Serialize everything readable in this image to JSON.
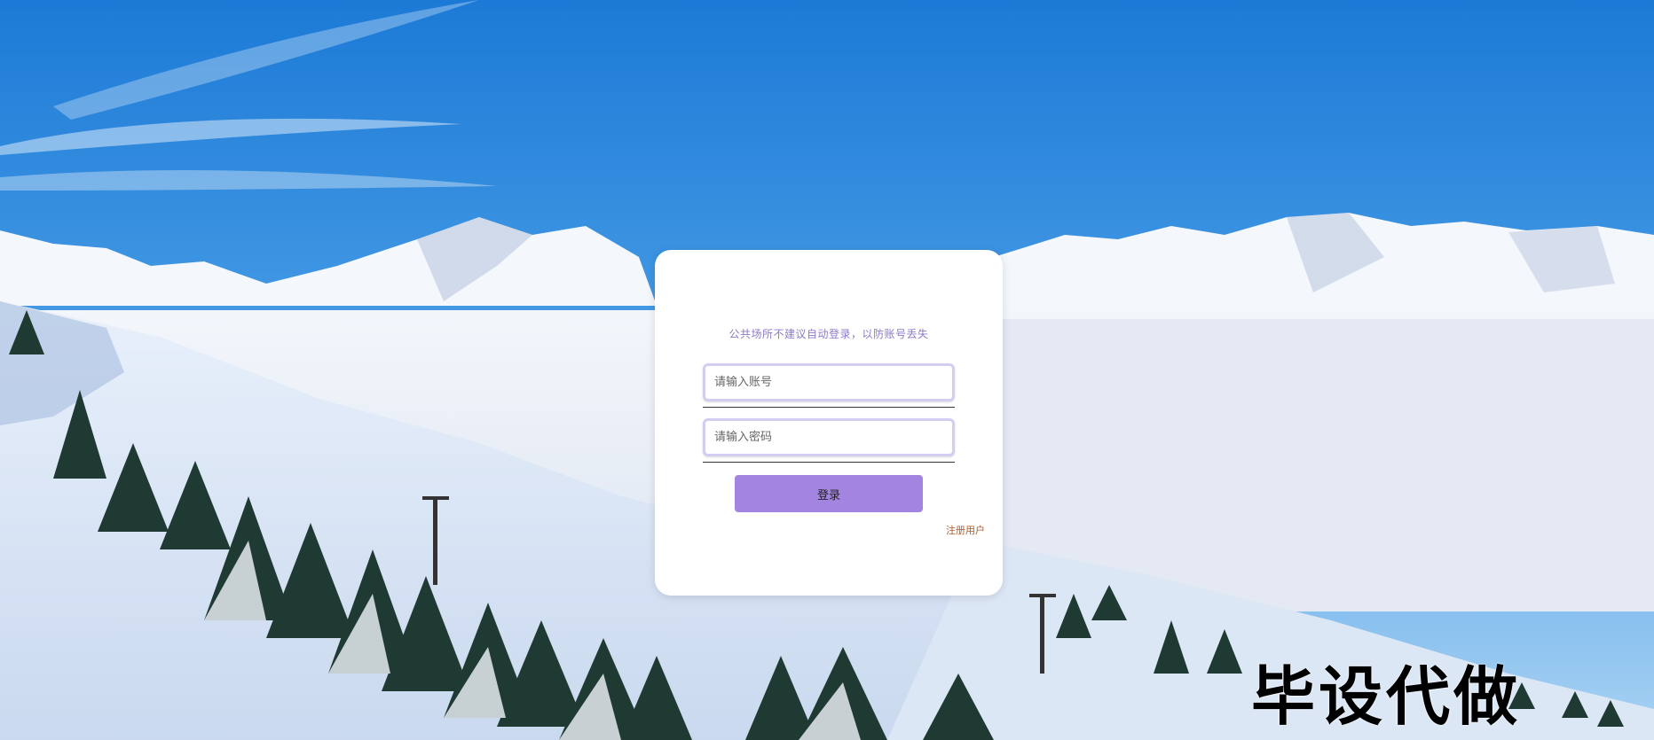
{
  "login": {
    "tip": "公共场所不建议自动登录，以防账号丢失",
    "username_placeholder": "请输入账号",
    "password_placeholder": "请输入密码",
    "login_button": "登录",
    "register_link": "注册用户"
  },
  "watermark": "毕设代做",
  "colors": {
    "accent": "#a384e0",
    "tip_text": "#8e79c9",
    "register_link": "#b35b2a"
  }
}
